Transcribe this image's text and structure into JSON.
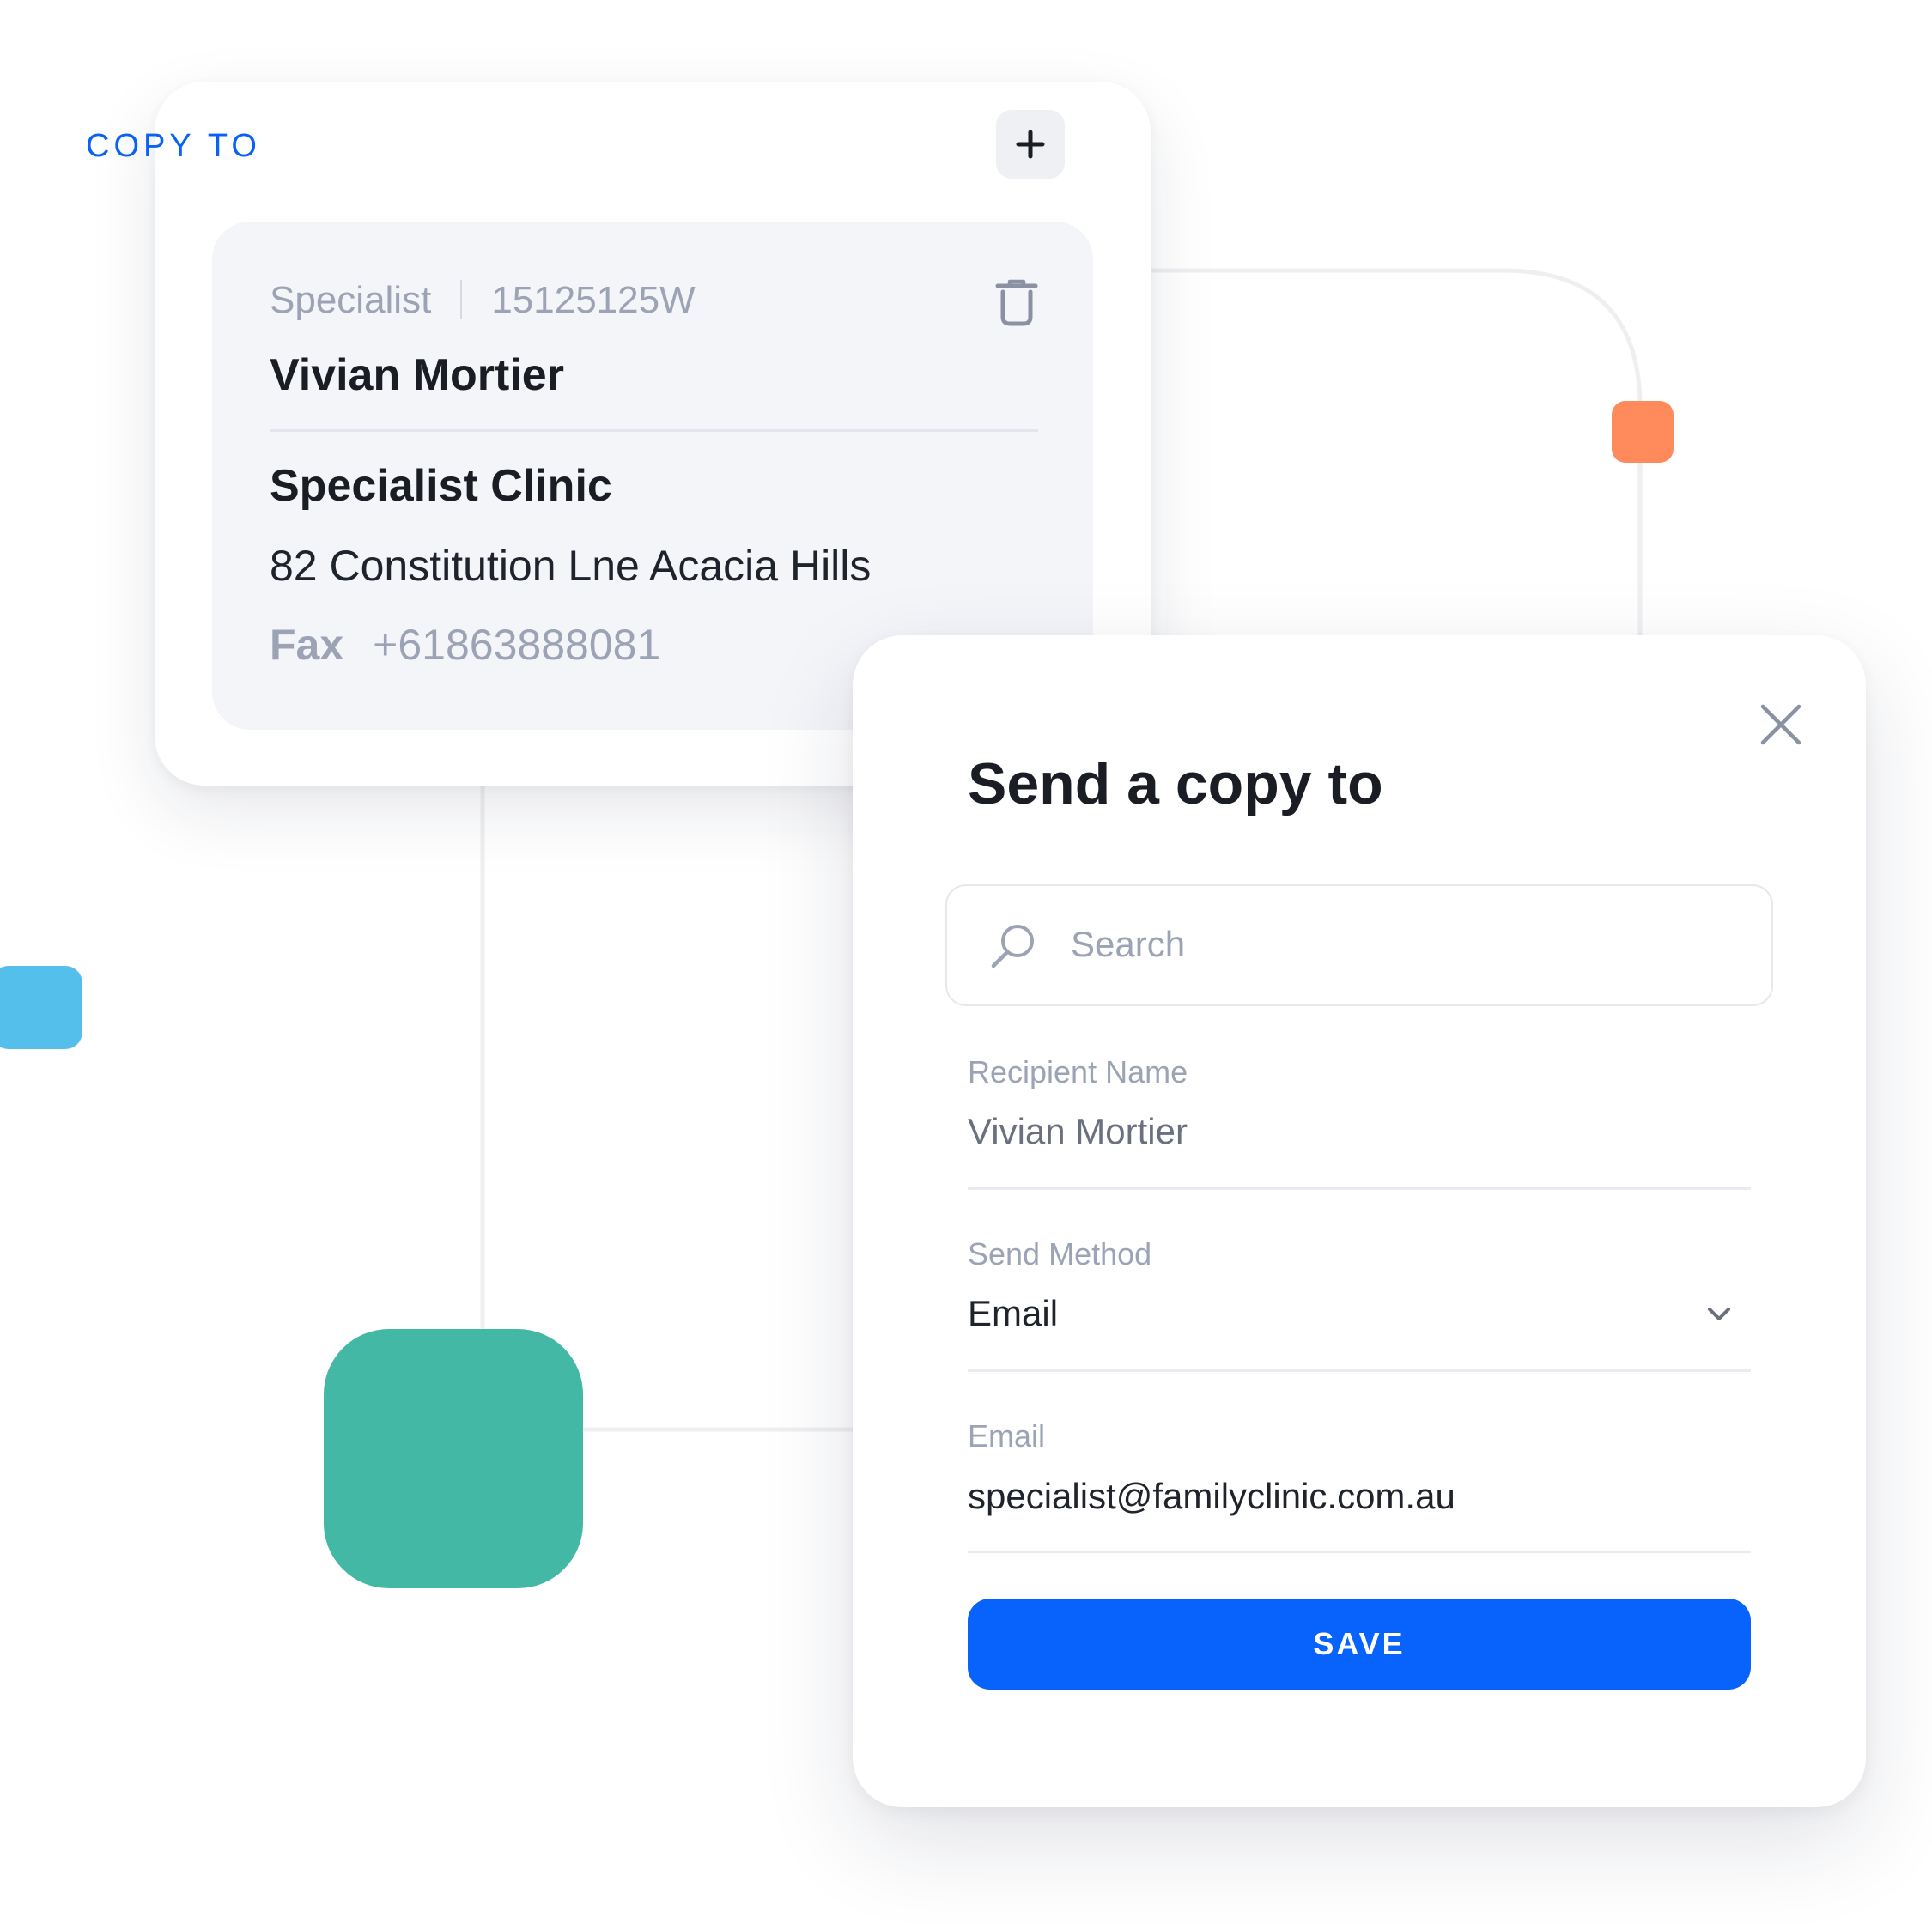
{
  "copy_card": {
    "title": "COPY TO",
    "add_icon": "plus-icon",
    "entry": {
      "role": "Specialist",
      "id": "15125125W",
      "delete_icon": "trash-icon",
      "name": "Vivian Mortier",
      "clinic": "Specialist Clinic",
      "address": "82 Constitution Lne Acacia Hills",
      "fax_label": "Fax",
      "fax_number": "+61863888081"
    }
  },
  "modal": {
    "title": "Send a copy to",
    "close_icon": "close-icon",
    "search": {
      "icon": "search-icon",
      "placeholder": "Search"
    },
    "recipient": {
      "label": "Recipient Name",
      "value": "Vivian Mortier"
    },
    "send_method": {
      "label": "Send Method",
      "value": "Email",
      "icon": "chevron-down-icon"
    },
    "email": {
      "label": "Email",
      "value": "specialist@familyclinic.com.au"
    },
    "save_label": "SAVE"
  },
  "colors": {
    "accent_blue": "#0863fd",
    "decor_orange": "#ff8a5b",
    "decor_sky": "#55bfec",
    "decor_teal": "#42b8a5"
  }
}
